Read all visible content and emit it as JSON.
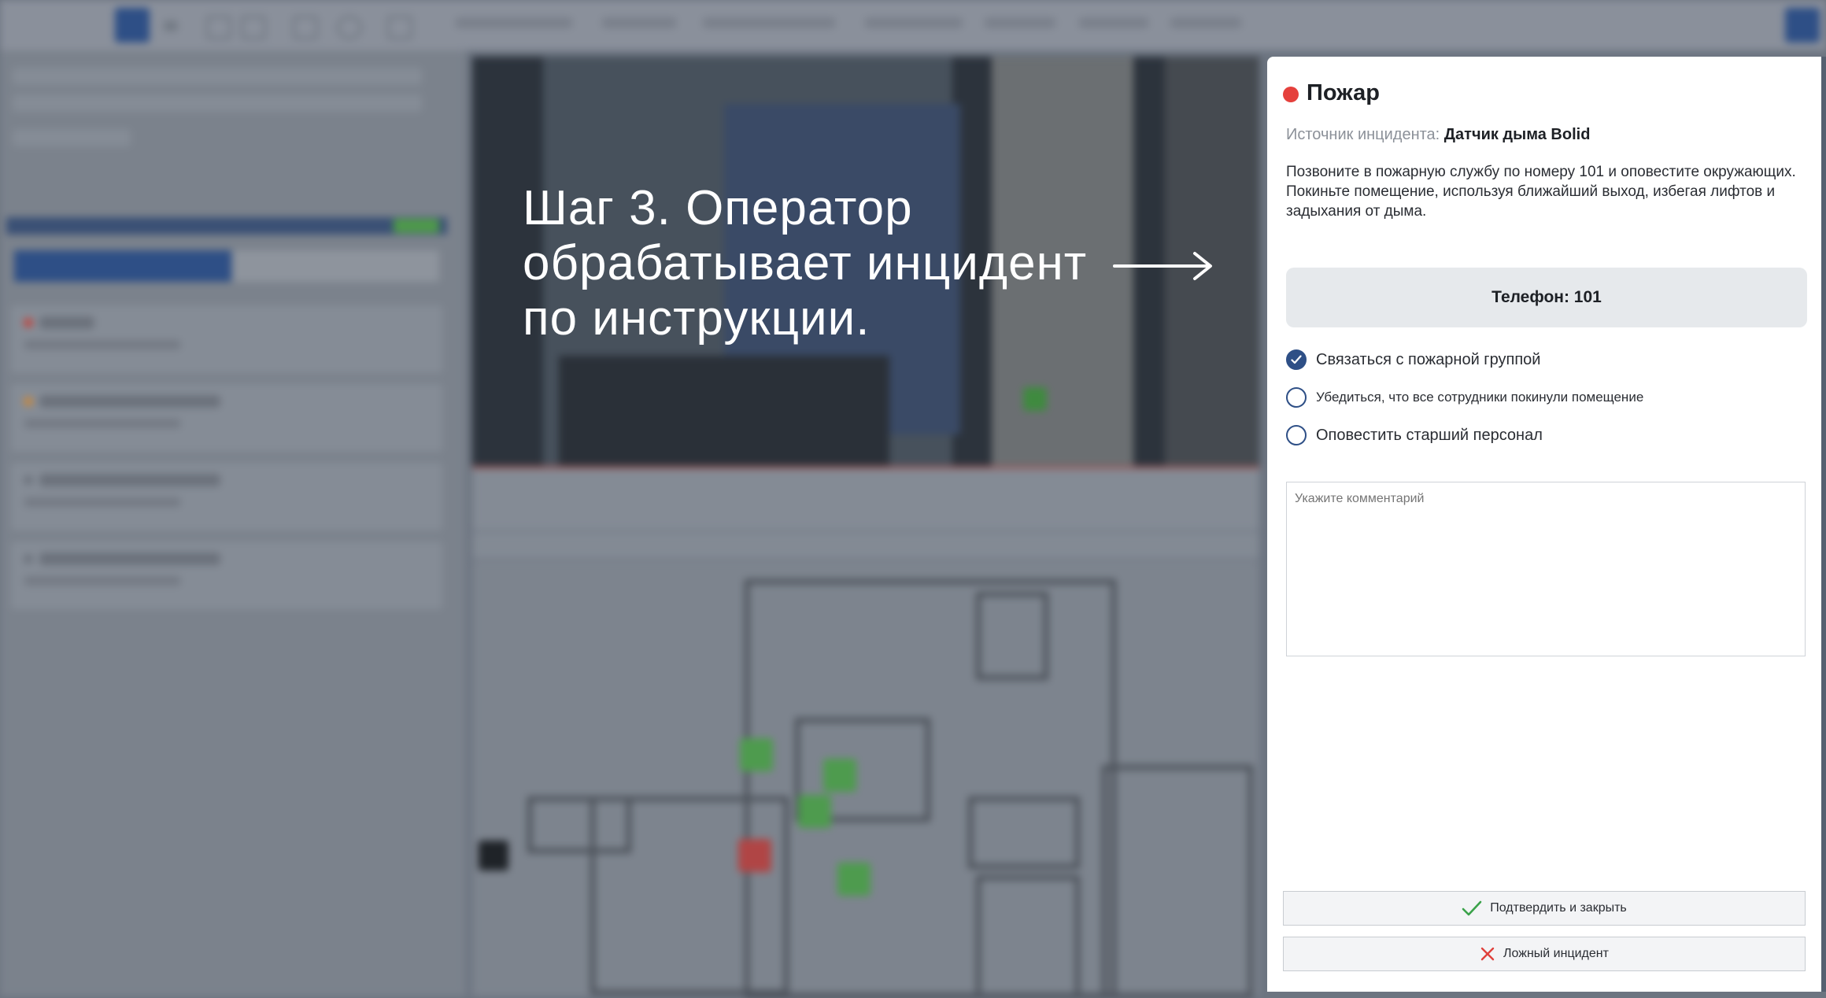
{
  "overlay": {
    "caption": "Шаг 3. Оператор\nобрабатывает инцидент\nпо инструкции."
  },
  "incident": {
    "status_color": "#e5403c",
    "title": "Пожар",
    "source_label": "Источник инцидента:",
    "source_value": "Датчик дыма Bolid",
    "instructions": "Позвоните в пожарную службу по номеру 101 и оповестите окружающих. Покиньте помещение, используя ближайший выход, избегая лифтов и задыхания от дыма.",
    "phone": "Телефон: 101",
    "checklist": [
      {
        "label": "Связаться с пожарной группой",
        "checked": true
      },
      {
        "label": "Убедиться, что все сотрудники покинули помещение",
        "checked": false
      },
      {
        "label": "Оповестить старший персонал",
        "checked": false
      }
    ],
    "comment_placeholder": "Укажите комментарий",
    "confirm_label": "Подтвердить и закрыть",
    "false_label": "Ложный инцидент"
  },
  "colors": {
    "accent": "#2e4f86",
    "confirm_icon": "#3aa24a",
    "false_icon": "#e0413c"
  }
}
